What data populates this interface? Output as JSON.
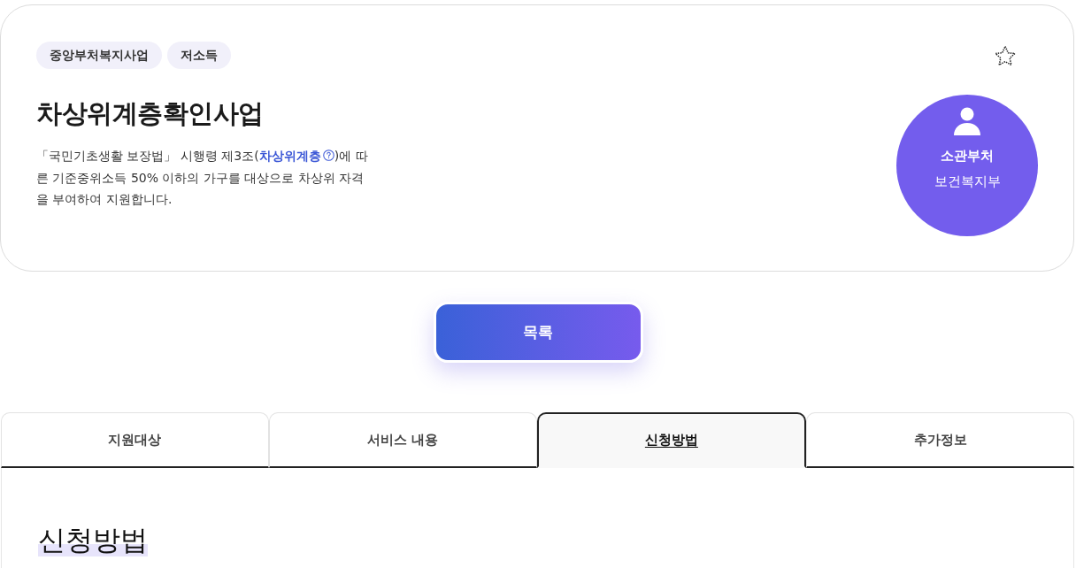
{
  "tags": [
    {
      "label": "중앙부처복지사업"
    },
    {
      "label": "저소득"
    }
  ],
  "title": "차상위계층확인사업",
  "description": {
    "before": "「국민기초생활 보장법」 시행령 제3조(",
    "link": "차상위계층",
    "after": ")에 따른 기준중위소득 50% 이하의 가구를 대상으로 차상위 자격을 부여하여 지원합니다."
  },
  "department": {
    "label": "소관부처",
    "value": "보건복지부"
  },
  "list_button": "목록",
  "tabs": [
    {
      "label": "지원대상",
      "selected": false
    },
    {
      "label": "서비스 내용",
      "selected": false
    },
    {
      "label": "신청방법",
      "selected": true
    },
    {
      "label": "추가정보",
      "selected": false
    }
  ],
  "section": {
    "heading": "신청방법"
  }
}
